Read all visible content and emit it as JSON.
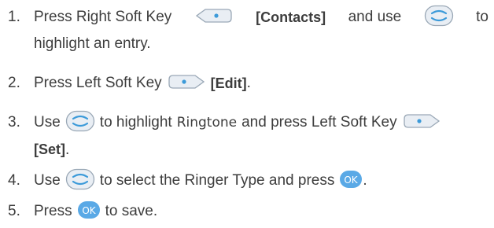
{
  "steps": [
    {
      "number": "1.",
      "line1": {
        "a": "Press Right Soft Key",
        "key_icon": "right-soft-key-icon",
        "bold": "[Contacts]",
        "b": "and use",
        "nav_icon": "navigation-key-icon",
        "c": "to"
      },
      "line2": "highlight an entry."
    },
    {
      "number": "2.",
      "a": "Press Left Soft Key",
      "key_icon": "left-soft-key-icon",
      "bold": "[Edit]",
      "end": "."
    },
    {
      "number": "3.",
      "line1": {
        "a": "Use",
        "nav_icon": "navigation-key-icon",
        "b": "to highlight",
        "code": "Ringtone",
        "c": "and press Left Soft Key",
        "key_icon": "left-soft-key-icon"
      },
      "line2": {
        "bold": "[Set]",
        "end": "."
      }
    },
    {
      "number": "4.",
      "a": "Use",
      "nav_icon": "navigation-key-icon",
      "b": "to select the Ringer Type and press",
      "ok_label": "OK",
      "end": "."
    },
    {
      "number": "5.",
      "a": "Press",
      "ok_label": "OK",
      "b": "to save."
    }
  ],
  "colors": {
    "text": "#3d3d3d",
    "key_fill": "#e9eef4",
    "key_stroke": "#9aa8b6",
    "ok_fill": "#5aa9e6",
    "ok_text": "#ffffff",
    "dot": "#3c9ad9"
  }
}
